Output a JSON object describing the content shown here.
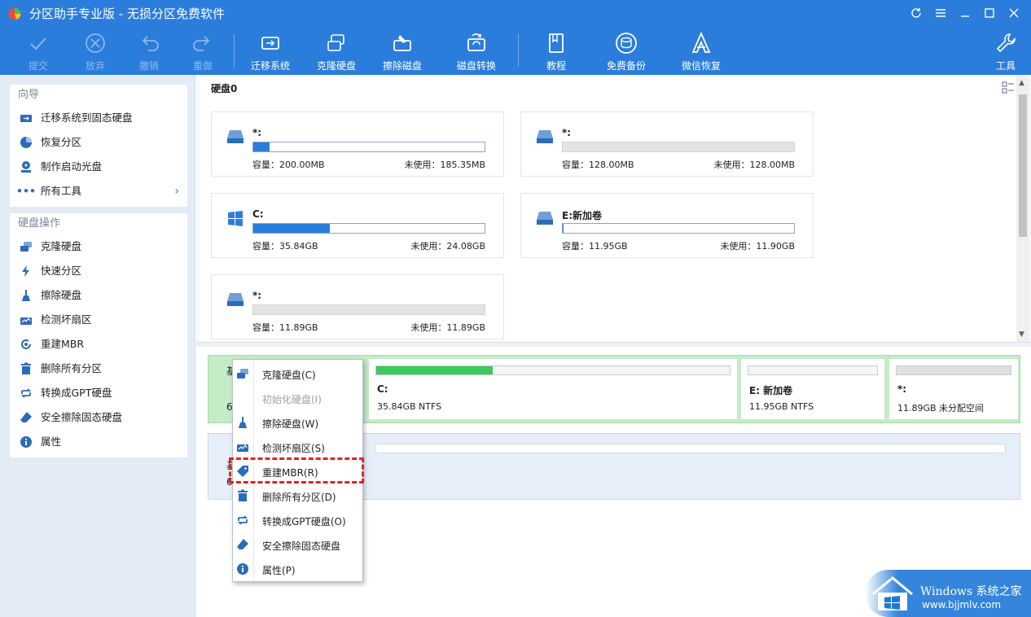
{
  "window": {
    "title": "分区助手专业版 - 无损分区免费软件"
  },
  "toolbar": {
    "commit": "提交",
    "discard": "放弃",
    "undo": "撤销",
    "redo": "重做",
    "migrate": "迁移系统",
    "clone": "克隆硬盘",
    "wipe": "擦除磁盘",
    "convert": "磁盘转换",
    "tutorial": "教程",
    "backup": "免费备份",
    "wechat": "微信恢复",
    "tools": "工具"
  },
  "sidebar": {
    "wizard_head": "向导",
    "wizard_items": [
      "迁移系统到固态硬盘",
      "恢复分区",
      "制作启动光盘",
      "所有工具"
    ],
    "ops_head": "硬盘操作",
    "ops_items": [
      "克隆硬盘",
      "快速分区",
      "擦除硬盘",
      "检测坏扇区",
      "重建MBR",
      "删除所有分区",
      "转换成GPT硬盘",
      "安全擦除固态硬盘",
      "属性"
    ]
  },
  "disk0": {
    "title": "硬盘0",
    "partitions": [
      {
        "name": "*:",
        "capacity": "容量：200.00MB",
        "free": "未使用：185.35MB",
        "used_fraction": 0.07
      },
      {
        "name": "*:",
        "capacity": "容量：128.00MB",
        "free": "未使用：128.00MB",
        "used_fraction": 0.0
      },
      {
        "name": "C:",
        "capacity": "容量：35.84GB",
        "free": "未使用：24.08GB",
        "used_fraction": 0.33
      },
      {
        "name": "E:新加卷",
        "capacity": "容量：11.95GB",
        "free": "未使用：11.90GB",
        "used_fraction": 0.004
      },
      {
        "name": "*:",
        "capacity": "容量：11.89GB",
        "free": "未使用：11.89GB",
        "used_fraction": 0.0
      }
    ]
  },
  "diskmap": {
    "row0_label_char": "基",
    "row0_label_num": "6",
    "row1_label_char": "基",
    "row1_label_num": "6",
    "segments": [
      {
        "name": "C:",
        "info": "35.84GB NTFS",
        "used_fraction": 0.33
      },
      {
        "name": "E: 新加卷",
        "info": "11.95GB NTFS",
        "used_fraction": 0.0
      },
      {
        "name": "*:",
        "info": "11.89GB 未分配空间",
        "used_fraction": 0.0
      }
    ]
  },
  "context_menu": {
    "items": [
      {
        "label": "克隆硬盘(C)",
        "enabled": true
      },
      {
        "label": "初始化硬盘(I)",
        "enabled": false
      },
      {
        "label": "擦除硬盘(W)",
        "enabled": true
      },
      {
        "label": "检测坏扇区(S)",
        "enabled": true
      },
      {
        "label": "重建MBR(R)",
        "enabled": true
      },
      {
        "label": "删除所有分区(D)",
        "enabled": true
      },
      {
        "label": "转换成GPT硬盘(O)",
        "enabled": true
      },
      {
        "label": "安全擦除固态硬盘",
        "enabled": true
      },
      {
        "label": "属性(P)",
        "enabled": true
      }
    ]
  },
  "watermark": {
    "line1": "Windows 系统之家",
    "line2": "www.bjjmlv.com"
  },
  "colors": {
    "accent": "#2b7ddc",
    "used_bar": "#2b7ddc",
    "green_bar": "#3bcb5c",
    "highlight": "#e02424"
  }
}
